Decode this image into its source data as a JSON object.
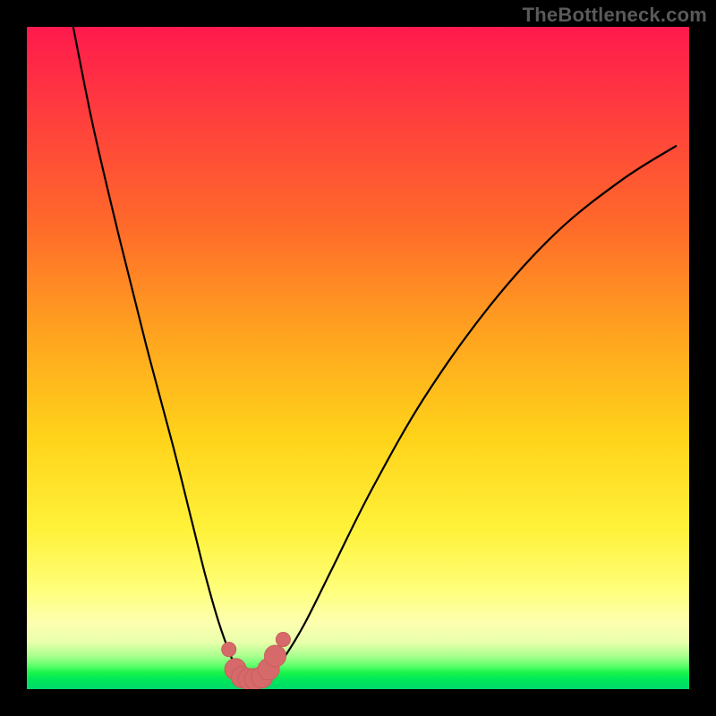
{
  "watermark": "TheBottleneck.com",
  "chart_data": {
    "type": "line",
    "title": "",
    "xlabel": "",
    "ylabel": "",
    "xlim": [
      0,
      100
    ],
    "ylim": [
      0,
      100
    ],
    "grid": false,
    "legend": false,
    "series": [
      {
        "name": "bottleneck-curve",
        "x": [
          7,
          10,
          14,
          18,
          22,
          25,
          27,
          29,
          31,
          32,
          33,
          34,
          35,
          36,
          37,
          39,
          42,
          46,
          52,
          60,
          70,
          80,
          90,
          98
        ],
        "y": [
          100,
          85,
          68,
          52,
          37,
          25,
          17,
          10,
          4.5,
          2.5,
          1.7,
          1.5,
          1.5,
          1.7,
          2.5,
          5,
          10,
          18,
          30,
          44,
          58,
          69,
          77,
          82
        ]
      },
      {
        "name": "highlight-dots",
        "x": [
          30.5,
          31.5,
          32.5,
          33.5,
          34.5,
          35.5,
          36.5,
          37.5,
          38.7
        ],
        "y": [
          6.0,
          3.0,
          1.8,
          1.5,
          1.5,
          1.8,
          3.0,
          5.0,
          7.5
        ]
      }
    ],
    "annotations": [],
    "colors": {
      "curve": "#000000",
      "dot_fill": "#d66a6a",
      "dot_stroke": "#c95c5c",
      "background_top": "#ff1a4d",
      "background_bottom": "#00d86a"
    }
  }
}
